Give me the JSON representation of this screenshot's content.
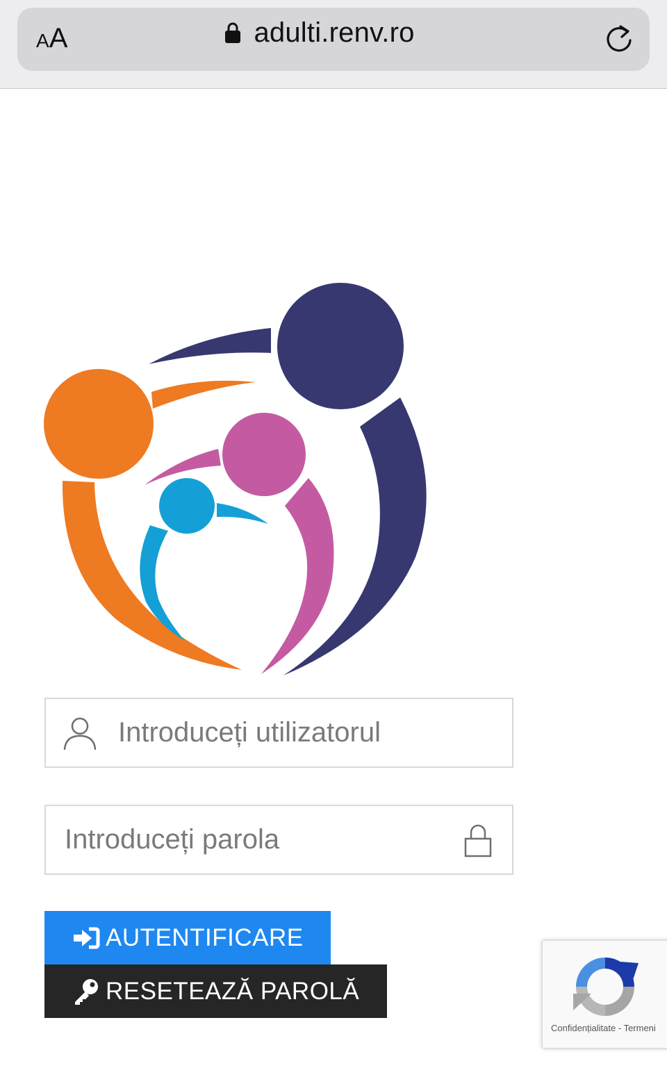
{
  "browser": {
    "text_size_small": "A",
    "text_size_large": "A",
    "url": "adulti.renv.ro"
  },
  "logo": {
    "colors": {
      "navy": "#373870",
      "orange": "#ee7a22",
      "pink": "#c45ba2",
      "blue": "#14a0d6"
    }
  },
  "login": {
    "username_placeholder": "Introduceți utilizatorul",
    "password_placeholder": "Introduceți parola",
    "login_label": "AUTENTIFICARE",
    "reset_label": "RESETEAZĂ PAROLĂ"
  },
  "recaptcha": {
    "privacy_label": "Confidențialitate",
    "separator": " - ",
    "terms_label": "Termeni"
  },
  "colors": {
    "primary_button": "#1e88f0",
    "secondary_button": "#262626"
  }
}
